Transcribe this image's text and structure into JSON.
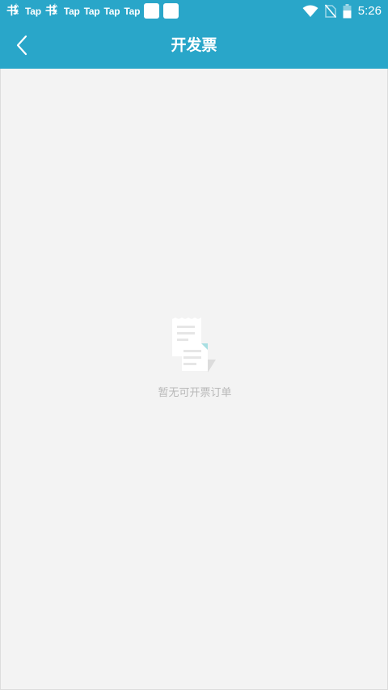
{
  "status_bar": {
    "notifications": [
      {
        "type": "novel",
        "big": "书",
        "small": "小说"
      },
      {
        "type": "app",
        "label": "Tap"
      },
      {
        "type": "novel",
        "big": "书",
        "small": "小说"
      },
      {
        "type": "app",
        "label": "Tap"
      },
      {
        "type": "app",
        "label": "Tap"
      },
      {
        "type": "app",
        "label": "Tap"
      },
      {
        "type": "app",
        "label": "Tap"
      },
      {
        "type": "box"
      },
      {
        "type": "box"
      }
    ],
    "icons": [
      "wifi-icon",
      "no-sim-icon",
      "battery-icon"
    ],
    "time": "5:26"
  },
  "toolbar": {
    "back_icon": "chevron-left-icon",
    "title": "开发票"
  },
  "empty_state": {
    "icon": "invoice-document-icon",
    "message": "暂无可开票订单"
  },
  "colors": {
    "primary": "#29a6c9",
    "background": "#f3f3f3",
    "empty_text": "#b8b8b8",
    "icon_accent": "#a8dfe2"
  }
}
